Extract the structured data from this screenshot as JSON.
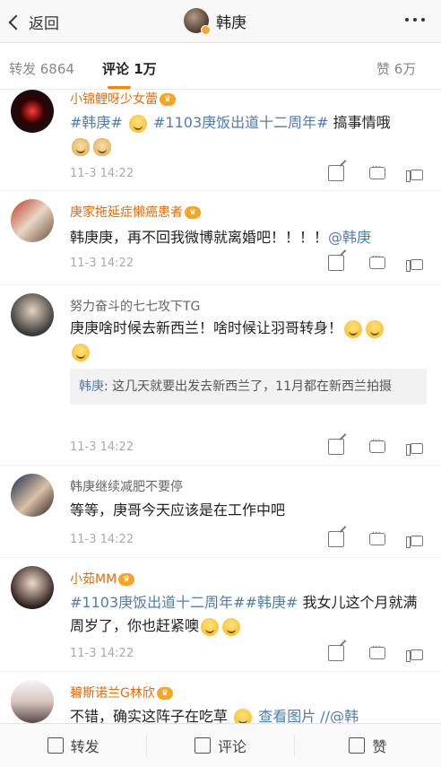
{
  "header": {
    "back_label": "返回",
    "title": "韩庚"
  },
  "tabs": {
    "repost": "转发 6864",
    "comments": "评论 1万",
    "likes": "赞 6万"
  },
  "comments": [
    {
      "user": "小锦鲤呀少女蕾",
      "text_tag1": "#韩庚#",
      "text_tag2": "#1103庚饭出道十二周年#",
      "text_rest": " 搞事情哦",
      "time": "11-3 14:22"
    },
    {
      "user": "庚家拖延症懒癌患者",
      "text": "韩庚庚，再不回我微博就离婚吧！！！！",
      "mention": "@韩庚",
      "time": "11-3 14:22"
    },
    {
      "user": "努力奋斗的七七攻下TG",
      "text": "庚庚啥时候去新西兰！啥时候让羽哥转身！",
      "reply_name": "韩庚",
      "reply_text": ": 这几天就要出发去新西兰了，11月都在新西兰拍摄",
      "time": "11-3 14:22"
    },
    {
      "user": "韩庚继续减肥不要停",
      "text": "等等，庚哥今天应该是在工作中吧",
      "time": "11-3 14:22"
    },
    {
      "user": "小茹MM",
      "text_tag1": "#1103庚饭出道十二周年#",
      "text_tag2": "#韩庚#",
      "text_rest": " 我女儿这个月就满周岁了，你也赶紧噢",
      "time": "11-3 14:22"
    },
    {
      "user": "碧斯诺兰G林欣",
      "text": "不错，确实这阵子在吃草",
      "link": "查看图片 //@韩"
    }
  ],
  "bottom": {
    "repost": "转发",
    "comment": "评论",
    "like": "赞"
  },
  "colors": {
    "accent": "#ff8200",
    "username": "#e86b0a",
    "link": "#507daf"
  }
}
